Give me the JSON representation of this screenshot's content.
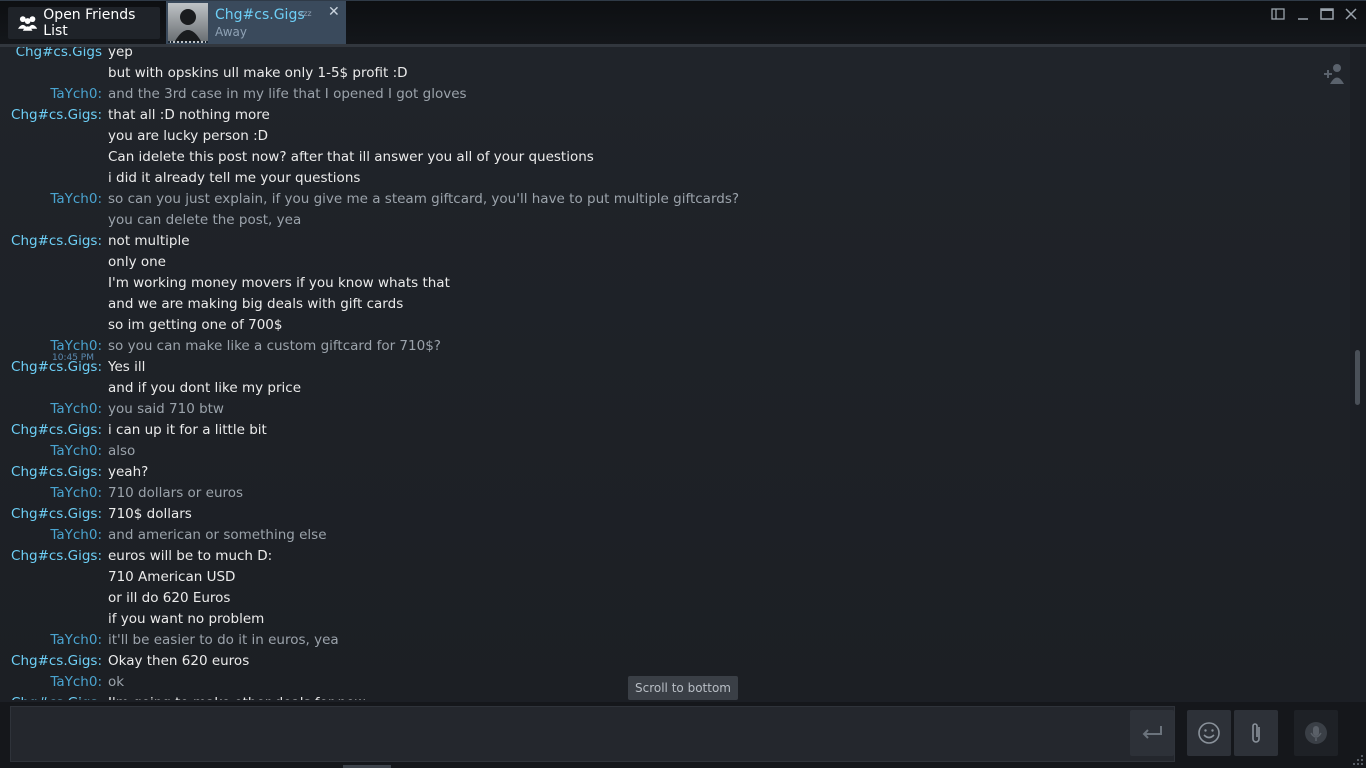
{
  "titlebar": {
    "friends_button_label": "Open Friends List",
    "tab": {
      "name": "Chg#cs.Gigs",
      "status": "Away",
      "away_indicator": "zzz"
    }
  },
  "chat": {
    "timestamp": "10:45 PM",
    "messages": [
      {
        "sender": "Chg#cs.Gigs",
        "text": "yep",
        "who": "them"
      },
      {
        "sender": "",
        "text": "but with opskins ull make only 1-5$ profit :D",
        "who": "them"
      },
      {
        "sender": "TaYch0:",
        "text": "and the 3rd case in my life that I opened I got gloves",
        "who": "me"
      },
      {
        "sender": "Chg#cs.Gigs:",
        "text": "that all :D nothing more",
        "who": "them"
      },
      {
        "sender": "",
        "text": "you are lucky person :D",
        "who": "them"
      },
      {
        "sender": "",
        "text": "Can idelete this post now? after that ill answer you all of your questions",
        "who": "them"
      },
      {
        "sender": "",
        "text": "i did it already tell me your questions",
        "who": "them"
      },
      {
        "sender": "TaYch0:",
        "text": "so can you just explain, if you give me a steam giftcard, you'll have to put multiple giftcards?",
        "who": "me"
      },
      {
        "sender": "",
        "text": "you can delete the post, yea",
        "who": "me"
      },
      {
        "sender": "Chg#cs.Gigs:",
        "text": "not multiple",
        "who": "them"
      },
      {
        "sender": "",
        "text": "only one",
        "who": "them"
      },
      {
        "sender": "",
        "text": "I'm working money movers if you know whats that",
        "who": "them"
      },
      {
        "sender": "",
        "text": "and we are making big deals with gift cards",
        "who": "them"
      },
      {
        "sender": "",
        "text": "so im getting one of 700$",
        "who": "them"
      },
      {
        "sender": "TaYch0:",
        "text": "so you can make like a custom giftcard for 710$?",
        "who": "me"
      },
      {
        "sender": "Chg#cs.Gigs:",
        "text": "Yes ill",
        "who": "them"
      },
      {
        "sender": "",
        "text": "and if you dont like my price",
        "who": "them"
      },
      {
        "sender": "TaYch0:",
        "text": "you said 710 btw",
        "who": "me"
      },
      {
        "sender": "Chg#cs.Gigs:",
        "text": "i can up it for a little bit",
        "who": "them"
      },
      {
        "sender": "TaYch0:",
        "text": "also",
        "who": "me"
      },
      {
        "sender": "Chg#cs.Gigs:",
        "text": "yeah?",
        "who": "them"
      },
      {
        "sender": "TaYch0:",
        "text": "710 dollars or euros",
        "who": "me"
      },
      {
        "sender": "Chg#cs.Gigs:",
        "text": "710$ dollars",
        "who": "them"
      },
      {
        "sender": "TaYch0:",
        "text": "and american or something else",
        "who": "me"
      },
      {
        "sender": "Chg#cs.Gigs:",
        "text": "euros will be to much D:",
        "who": "them"
      },
      {
        "sender": "",
        "text": "710 American USD",
        "who": "them"
      },
      {
        "sender": "",
        "text": "or ill do 620 Euros",
        "who": "them"
      },
      {
        "sender": "",
        "text": "if you want no problem",
        "who": "them"
      },
      {
        "sender": "TaYch0:",
        "text": "it'll be easier to do it in euros, yea",
        "who": "me"
      },
      {
        "sender": "Chg#cs.Gigs:",
        "text": "Okay then 620 euros",
        "who": "them"
      },
      {
        "sender": "TaYch0:",
        "text": "ok",
        "who": "me"
      },
      {
        "sender": "Chg#cs.Gigs:",
        "text": "I'm going to make other deals for now",
        "who": "them"
      }
    ]
  },
  "scroll_to_bottom_label": "Scroll to bottom",
  "input": {
    "value": "",
    "placeholder": ""
  },
  "icons": {
    "friends": "friends-group-icon",
    "add_friend": "add-friend-icon",
    "send": "send-enter-icon",
    "emoticon": "smiley-icon",
    "attach": "paperclip-icon",
    "voice": "voice-chat-icon"
  },
  "colors": {
    "them_sender": "#6dcff6",
    "me_sender": "#4aa4d0",
    "them_text": "#ebebeb",
    "me_text": "#9ba3ab",
    "background": "#1c1f25"
  }
}
